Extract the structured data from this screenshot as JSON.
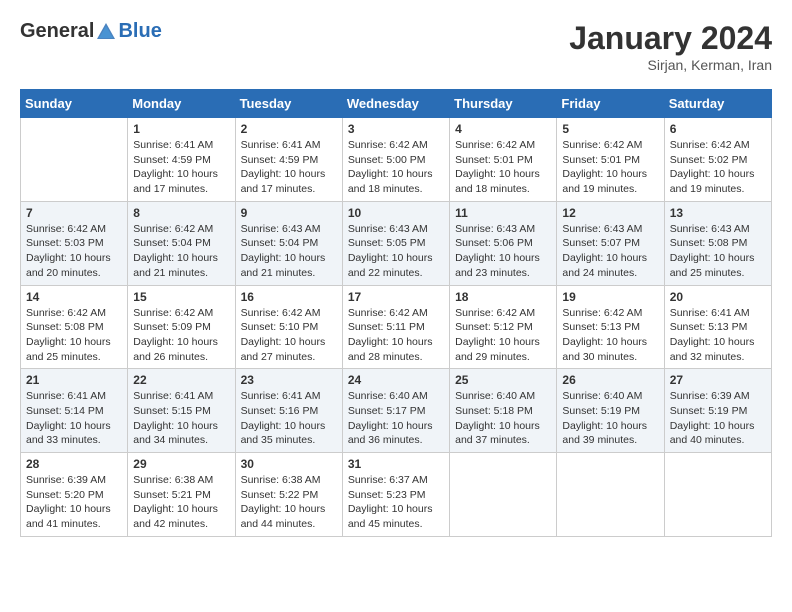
{
  "header": {
    "logo_general": "General",
    "logo_blue": "Blue",
    "month_title": "January 2024",
    "location": "Sirjan, Kerman, Iran"
  },
  "days_of_week": [
    "Sunday",
    "Monday",
    "Tuesday",
    "Wednesday",
    "Thursday",
    "Friday",
    "Saturday"
  ],
  "weeks": [
    [
      {
        "day": "",
        "sunrise": "",
        "sunset": "",
        "daylight": ""
      },
      {
        "day": "1",
        "sunrise": "Sunrise: 6:41 AM",
        "sunset": "Sunset: 4:59 PM",
        "daylight": "Daylight: 10 hours and 17 minutes."
      },
      {
        "day": "2",
        "sunrise": "Sunrise: 6:41 AM",
        "sunset": "Sunset: 4:59 PM",
        "daylight": "Daylight: 10 hours and 17 minutes."
      },
      {
        "day": "3",
        "sunrise": "Sunrise: 6:42 AM",
        "sunset": "Sunset: 5:00 PM",
        "daylight": "Daylight: 10 hours and 18 minutes."
      },
      {
        "day": "4",
        "sunrise": "Sunrise: 6:42 AM",
        "sunset": "Sunset: 5:01 PM",
        "daylight": "Daylight: 10 hours and 18 minutes."
      },
      {
        "day": "5",
        "sunrise": "Sunrise: 6:42 AM",
        "sunset": "Sunset: 5:01 PM",
        "daylight": "Daylight: 10 hours and 19 minutes."
      },
      {
        "day": "6",
        "sunrise": "Sunrise: 6:42 AM",
        "sunset": "Sunset: 5:02 PM",
        "daylight": "Daylight: 10 hours and 19 minutes."
      }
    ],
    [
      {
        "day": "7",
        "sunrise": "Sunrise: 6:42 AM",
        "sunset": "Sunset: 5:03 PM",
        "daylight": "Daylight: 10 hours and 20 minutes."
      },
      {
        "day": "8",
        "sunrise": "Sunrise: 6:42 AM",
        "sunset": "Sunset: 5:04 PM",
        "daylight": "Daylight: 10 hours and 21 minutes."
      },
      {
        "day": "9",
        "sunrise": "Sunrise: 6:43 AM",
        "sunset": "Sunset: 5:04 PM",
        "daylight": "Daylight: 10 hours and 21 minutes."
      },
      {
        "day": "10",
        "sunrise": "Sunrise: 6:43 AM",
        "sunset": "Sunset: 5:05 PM",
        "daylight": "Daylight: 10 hours and 22 minutes."
      },
      {
        "day": "11",
        "sunrise": "Sunrise: 6:43 AM",
        "sunset": "Sunset: 5:06 PM",
        "daylight": "Daylight: 10 hours and 23 minutes."
      },
      {
        "day": "12",
        "sunrise": "Sunrise: 6:43 AM",
        "sunset": "Sunset: 5:07 PM",
        "daylight": "Daylight: 10 hours and 24 minutes."
      },
      {
        "day": "13",
        "sunrise": "Sunrise: 6:43 AM",
        "sunset": "Sunset: 5:08 PM",
        "daylight": "Daylight: 10 hours and 25 minutes."
      }
    ],
    [
      {
        "day": "14",
        "sunrise": "Sunrise: 6:42 AM",
        "sunset": "Sunset: 5:08 PM",
        "daylight": "Daylight: 10 hours and 25 minutes."
      },
      {
        "day": "15",
        "sunrise": "Sunrise: 6:42 AM",
        "sunset": "Sunset: 5:09 PM",
        "daylight": "Daylight: 10 hours and 26 minutes."
      },
      {
        "day": "16",
        "sunrise": "Sunrise: 6:42 AM",
        "sunset": "Sunset: 5:10 PM",
        "daylight": "Daylight: 10 hours and 27 minutes."
      },
      {
        "day": "17",
        "sunrise": "Sunrise: 6:42 AM",
        "sunset": "Sunset: 5:11 PM",
        "daylight": "Daylight: 10 hours and 28 minutes."
      },
      {
        "day": "18",
        "sunrise": "Sunrise: 6:42 AM",
        "sunset": "Sunset: 5:12 PM",
        "daylight": "Daylight: 10 hours and 29 minutes."
      },
      {
        "day": "19",
        "sunrise": "Sunrise: 6:42 AM",
        "sunset": "Sunset: 5:13 PM",
        "daylight": "Daylight: 10 hours and 30 minutes."
      },
      {
        "day": "20",
        "sunrise": "Sunrise: 6:41 AM",
        "sunset": "Sunset: 5:13 PM",
        "daylight": "Daylight: 10 hours and 32 minutes."
      }
    ],
    [
      {
        "day": "21",
        "sunrise": "Sunrise: 6:41 AM",
        "sunset": "Sunset: 5:14 PM",
        "daylight": "Daylight: 10 hours and 33 minutes."
      },
      {
        "day": "22",
        "sunrise": "Sunrise: 6:41 AM",
        "sunset": "Sunset: 5:15 PM",
        "daylight": "Daylight: 10 hours and 34 minutes."
      },
      {
        "day": "23",
        "sunrise": "Sunrise: 6:41 AM",
        "sunset": "Sunset: 5:16 PM",
        "daylight": "Daylight: 10 hours and 35 minutes."
      },
      {
        "day": "24",
        "sunrise": "Sunrise: 6:40 AM",
        "sunset": "Sunset: 5:17 PM",
        "daylight": "Daylight: 10 hours and 36 minutes."
      },
      {
        "day": "25",
        "sunrise": "Sunrise: 6:40 AM",
        "sunset": "Sunset: 5:18 PM",
        "daylight": "Daylight: 10 hours and 37 minutes."
      },
      {
        "day": "26",
        "sunrise": "Sunrise: 6:40 AM",
        "sunset": "Sunset: 5:19 PM",
        "daylight": "Daylight: 10 hours and 39 minutes."
      },
      {
        "day": "27",
        "sunrise": "Sunrise: 6:39 AM",
        "sunset": "Sunset: 5:19 PM",
        "daylight": "Daylight: 10 hours and 40 minutes."
      }
    ],
    [
      {
        "day": "28",
        "sunrise": "Sunrise: 6:39 AM",
        "sunset": "Sunset: 5:20 PM",
        "daylight": "Daylight: 10 hours and 41 minutes."
      },
      {
        "day": "29",
        "sunrise": "Sunrise: 6:38 AM",
        "sunset": "Sunset: 5:21 PM",
        "daylight": "Daylight: 10 hours and 42 minutes."
      },
      {
        "day": "30",
        "sunrise": "Sunrise: 6:38 AM",
        "sunset": "Sunset: 5:22 PM",
        "daylight": "Daylight: 10 hours and 44 minutes."
      },
      {
        "day": "31",
        "sunrise": "Sunrise: 6:37 AM",
        "sunset": "Sunset: 5:23 PM",
        "daylight": "Daylight: 10 hours and 45 minutes."
      },
      {
        "day": "",
        "sunrise": "",
        "sunset": "",
        "daylight": ""
      },
      {
        "day": "",
        "sunrise": "",
        "sunset": "",
        "daylight": ""
      },
      {
        "day": "",
        "sunrise": "",
        "sunset": "",
        "daylight": ""
      }
    ]
  ]
}
